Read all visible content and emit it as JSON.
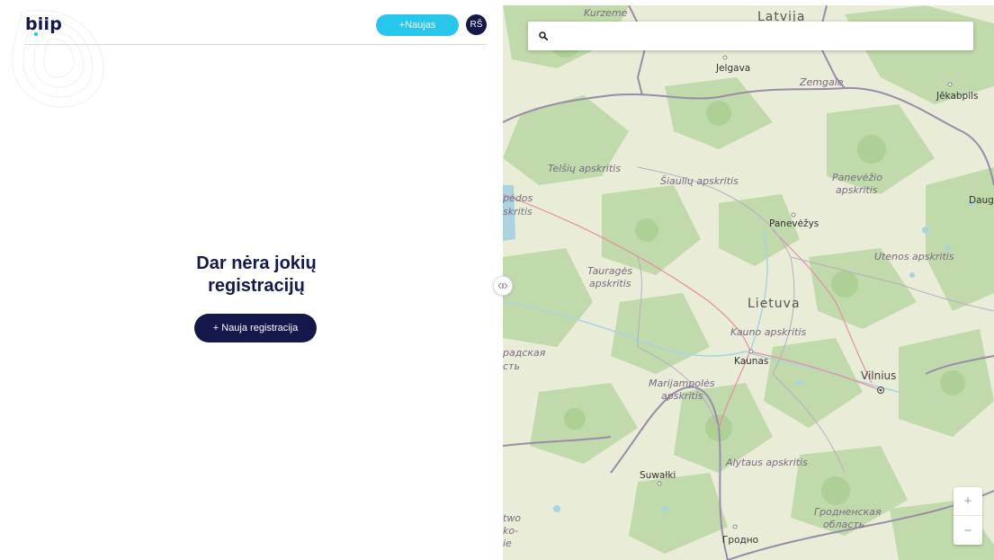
{
  "brand": {
    "logo_text": "biip"
  },
  "header": {
    "new_button_label": "+Naujas",
    "avatar_initials": "RŠ"
  },
  "empty_state": {
    "title_line1": "Dar nėra jokių",
    "title_line2": "registracijų",
    "button_label": "+ Nauja registracija"
  },
  "map": {
    "search": {
      "value": "",
      "placeholder": ""
    },
    "zoom_in_label": "+",
    "zoom_out_label": "−",
    "labels": {
      "kurzeme": "Kurzeme",
      "latvija": "Latvija",
      "jelgava": "Jelgava",
      "zemgale": "Zemgale",
      "jekabpils": "Jēkabpils",
      "telsiu": "Telšių apskritis",
      "siauliu": "Šiaulių apskritis",
      "panevezio_1": "Panevėžio",
      "panevezio_2": "apskritis",
      "pedos": "pėdos",
      "skritis": "skritis",
      "daug": "Daug",
      "panevezys": "Panevėžys",
      "utenos": "Utenos apskritis",
      "taurages_1": "Tauragės",
      "taurages_2": "apskritis",
      "lietuva": "Lietuva",
      "kauno": "Kauno apskritis",
      "radskaya": "радская",
      "st": "сть",
      "kaunas": "Kaunas",
      "vilnius": "Vilnius",
      "marijampoles_1": "Marijampolės",
      "marijampoles_2": "apskritis",
      "alytaus": "Alytaus apskritis",
      "suwalki": "Suwałki",
      "grodnenskaya_1": "Гродненская",
      "grodnenskaya_2": "область",
      "grodno": "Гродно",
      "two": "two",
      "ko": "ko-",
      "ie": "ie"
    }
  },
  "colors": {
    "brand_navy": "#14184a",
    "accent_cyan": "#27c6ea",
    "map_land": "#e9ecd6",
    "map_forest": "#b9d7a4",
    "map_border": "#9a8ca8",
    "map_road": "#e48fa2"
  }
}
